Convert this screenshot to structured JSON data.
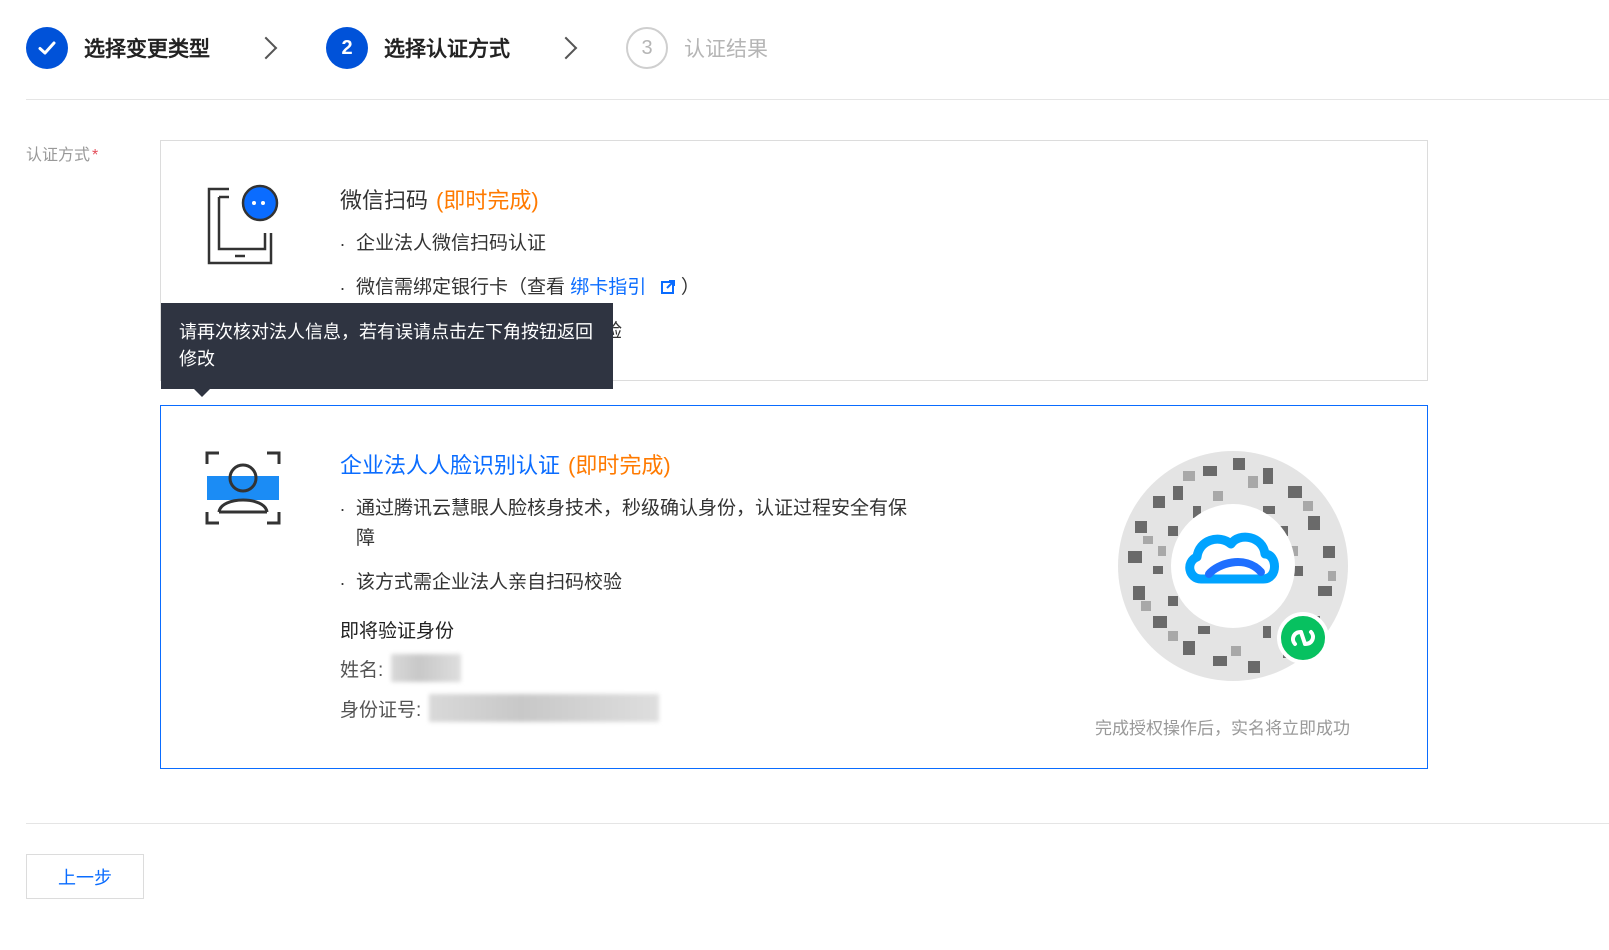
{
  "steps": [
    {
      "number": "1",
      "label": "选择变更类型",
      "status": "done"
    },
    {
      "number": "2",
      "label": "选择认证方式",
      "status": "active"
    },
    {
      "number": "3",
      "label": "认证结果",
      "status": "pending"
    }
  ],
  "form": {
    "label": "认证方式",
    "required_mark": "*"
  },
  "option_wechat": {
    "title": "微信扫码",
    "tag": "(即时完成)",
    "bullets": [
      "企业法人微信扫码认证",
      "微信需绑定银行卡（查看",
      "该方式需企业法人亲自扫码校验"
    ],
    "link_text": "绑卡指引",
    "bullet2_suffix": "）",
    "bullet3_visible": "校验",
    "icon": "tablet-chat-icon"
  },
  "option_face": {
    "title": "企业法人人脸识别认证",
    "tag": "(即时完成)",
    "bullets": [
      "通过腾讯云慧眼人脸核身技术，秒级确认身份，认证过程安全有保障",
      "该方式需企业法人亲自扫码校验"
    ],
    "verify_title": "即将验证身份",
    "name_label": "姓名:",
    "id_label": "身份证号:",
    "qr_caption": "完成授权操作后，实名将立即成功",
    "icon": "face-scan-icon"
  },
  "tooltip": {
    "text": "请再次核对法人信息，若有误请点击左下角按钮返回修改"
  },
  "footer": {
    "back_label": "上一步"
  },
  "colors": {
    "primary": "#0052d9",
    "link": "#0a6cff",
    "tag": "#ff7a00",
    "tooltip_bg": "#2f3441",
    "miniprogram_green": "#07c160"
  }
}
